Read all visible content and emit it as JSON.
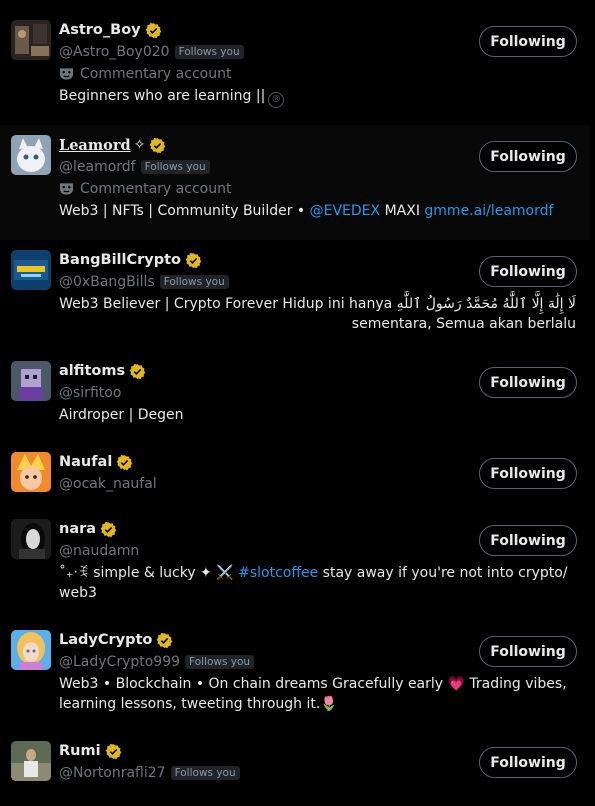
{
  "colors": {
    "background": "#000000",
    "text": "#e7e9ea",
    "muted": "#71767b",
    "link": "#1d9bf0",
    "badge": "#e2b719"
  },
  "follows_you_label": "Follows you",
  "following_label": "Following",
  "commentary_label": "Commentary account",
  "users": [
    {
      "name": "Astro_Boy",
      "handle": "@Astro_Boy020",
      "follows_you": true,
      "commentary": true,
      "bio": "Beginners who are learning ||",
      "bio_suffix_icon": "registered-icon",
      "avatar": "dark-room"
    },
    {
      "name": "Leamord",
      "name_suffix": "✧",
      "handle": "@leamordf",
      "follows_you": true,
      "commentary": true,
      "bio_prefix": "Web3 | NFTs | Community Builder • ",
      "bio_link1": "@EVEDEX",
      "bio_mid": " MAXI ",
      "bio_link2": "gmme.ai/leamordf",
      "avatar": "white-cat"
    },
    {
      "name": "BangBillCrypto",
      "handle": "@0xBangBills",
      "follows_you": true,
      "bio_line1": "Web3 Believer | Crypto Forever Hidup ini hanya لَا إِلَٰهَ إِلَّا ٱللَّٰهُ مُحَمَّدٌ رَسُولُ ٱللَّٰهِ",
      "bio_line2": "sementara, Semua akan berlalu",
      "avatar": "blue-logo"
    },
    {
      "name": "alfitoms",
      "handle": "@sirfitoo",
      "follows_you": false,
      "bio": "Airdroper | Degen",
      "avatar": "pixel-face"
    },
    {
      "name": "Naufal",
      "handle": "@ocak_naufal",
      "follows_you": false,
      "bio": "",
      "avatar": "orange-anime"
    },
    {
      "name": "nara",
      "handle": "@naudamn",
      "follows_you": false,
      "bio_prefix": "˚₊‧ꉂ simple & lucky ✦ ⚔️ ",
      "bio_link1": "#slotcoffee",
      "bio_suffix": " stay away if you're not into crypto/",
      "bio_line2": "web3",
      "avatar": "bw-girl"
    },
    {
      "name": "LadyCrypto",
      "handle": "@LadyCrypto999",
      "follows_you": true,
      "bio_line1": "Web3 • Blockchain • On chain dreams Gracefully early ",
      "bio_heart": "💗",
      "bio_line1_end": " Trading vibes,",
      "bio_line2": "learning lessons, tweeting through it.",
      "bio_line2_end": "🌷",
      "avatar": "pastel-lady"
    },
    {
      "name": "Rumi",
      "handle": "@Nortonrafli27",
      "follows_you": true,
      "bio": "",
      "avatar": "outdoor-photo"
    }
  ]
}
